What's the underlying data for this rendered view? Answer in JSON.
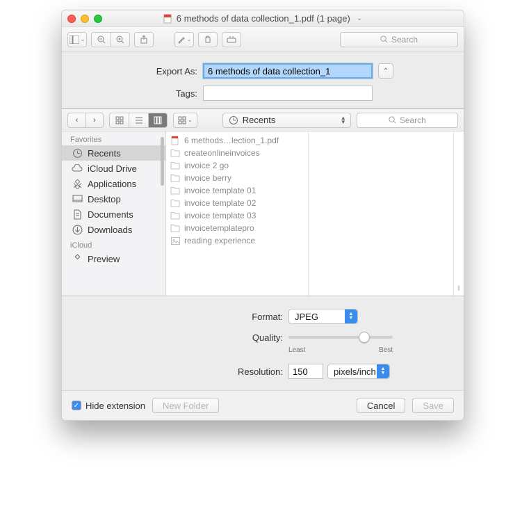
{
  "window": {
    "title": "6 methods of data collection_1.pdf (1 page)"
  },
  "toolbar_search_placeholder": "Search",
  "export": {
    "export_as_label": "Export As:",
    "filename": "6 methods of data collection_1",
    "tags_label": "Tags:",
    "tags_value": ""
  },
  "finder": {
    "location": "Recents",
    "search_placeholder": "Search",
    "sidebar": {
      "favorites_header": "Favorites",
      "icloud_header": "iCloud",
      "items": [
        {
          "label": "Recents",
          "icon": "clock"
        },
        {
          "label": "iCloud Drive",
          "icon": "cloud"
        },
        {
          "label": "Applications",
          "icon": "apps"
        },
        {
          "label": "Desktop",
          "icon": "desktop"
        },
        {
          "label": "Documents",
          "icon": "doc"
        },
        {
          "label": "Downloads",
          "icon": "download"
        },
        {
          "label": "Preview",
          "icon": "apps"
        }
      ]
    },
    "files": [
      {
        "name": "6 methods…lection_1.pdf",
        "kind": "pdf"
      },
      {
        "name": "createonlineinvoices",
        "kind": "folder"
      },
      {
        "name": "invoice 2 go",
        "kind": "folder"
      },
      {
        "name": "invoice berry",
        "kind": "folder"
      },
      {
        "name": "invoice template 01",
        "kind": "folder"
      },
      {
        "name": "invoice template 02",
        "kind": "folder"
      },
      {
        "name": "invoice template 03",
        "kind": "folder"
      },
      {
        "name": "invoicetemplatepro",
        "kind": "folder"
      },
      {
        "name": "reading experience",
        "kind": "image"
      }
    ]
  },
  "options": {
    "format_label": "Format:",
    "format_value": "JPEG",
    "quality_label": "Quality:",
    "quality_least": "Least",
    "quality_best": "Best",
    "quality_pos_pct": 75,
    "resolution_label": "Resolution:",
    "resolution_value": "150",
    "resolution_unit": "pixels/inch"
  },
  "bottom": {
    "hide_ext_label": "Hide extension",
    "hide_ext_checked": true,
    "new_folder": "New Folder",
    "cancel": "Cancel",
    "save": "Save"
  }
}
